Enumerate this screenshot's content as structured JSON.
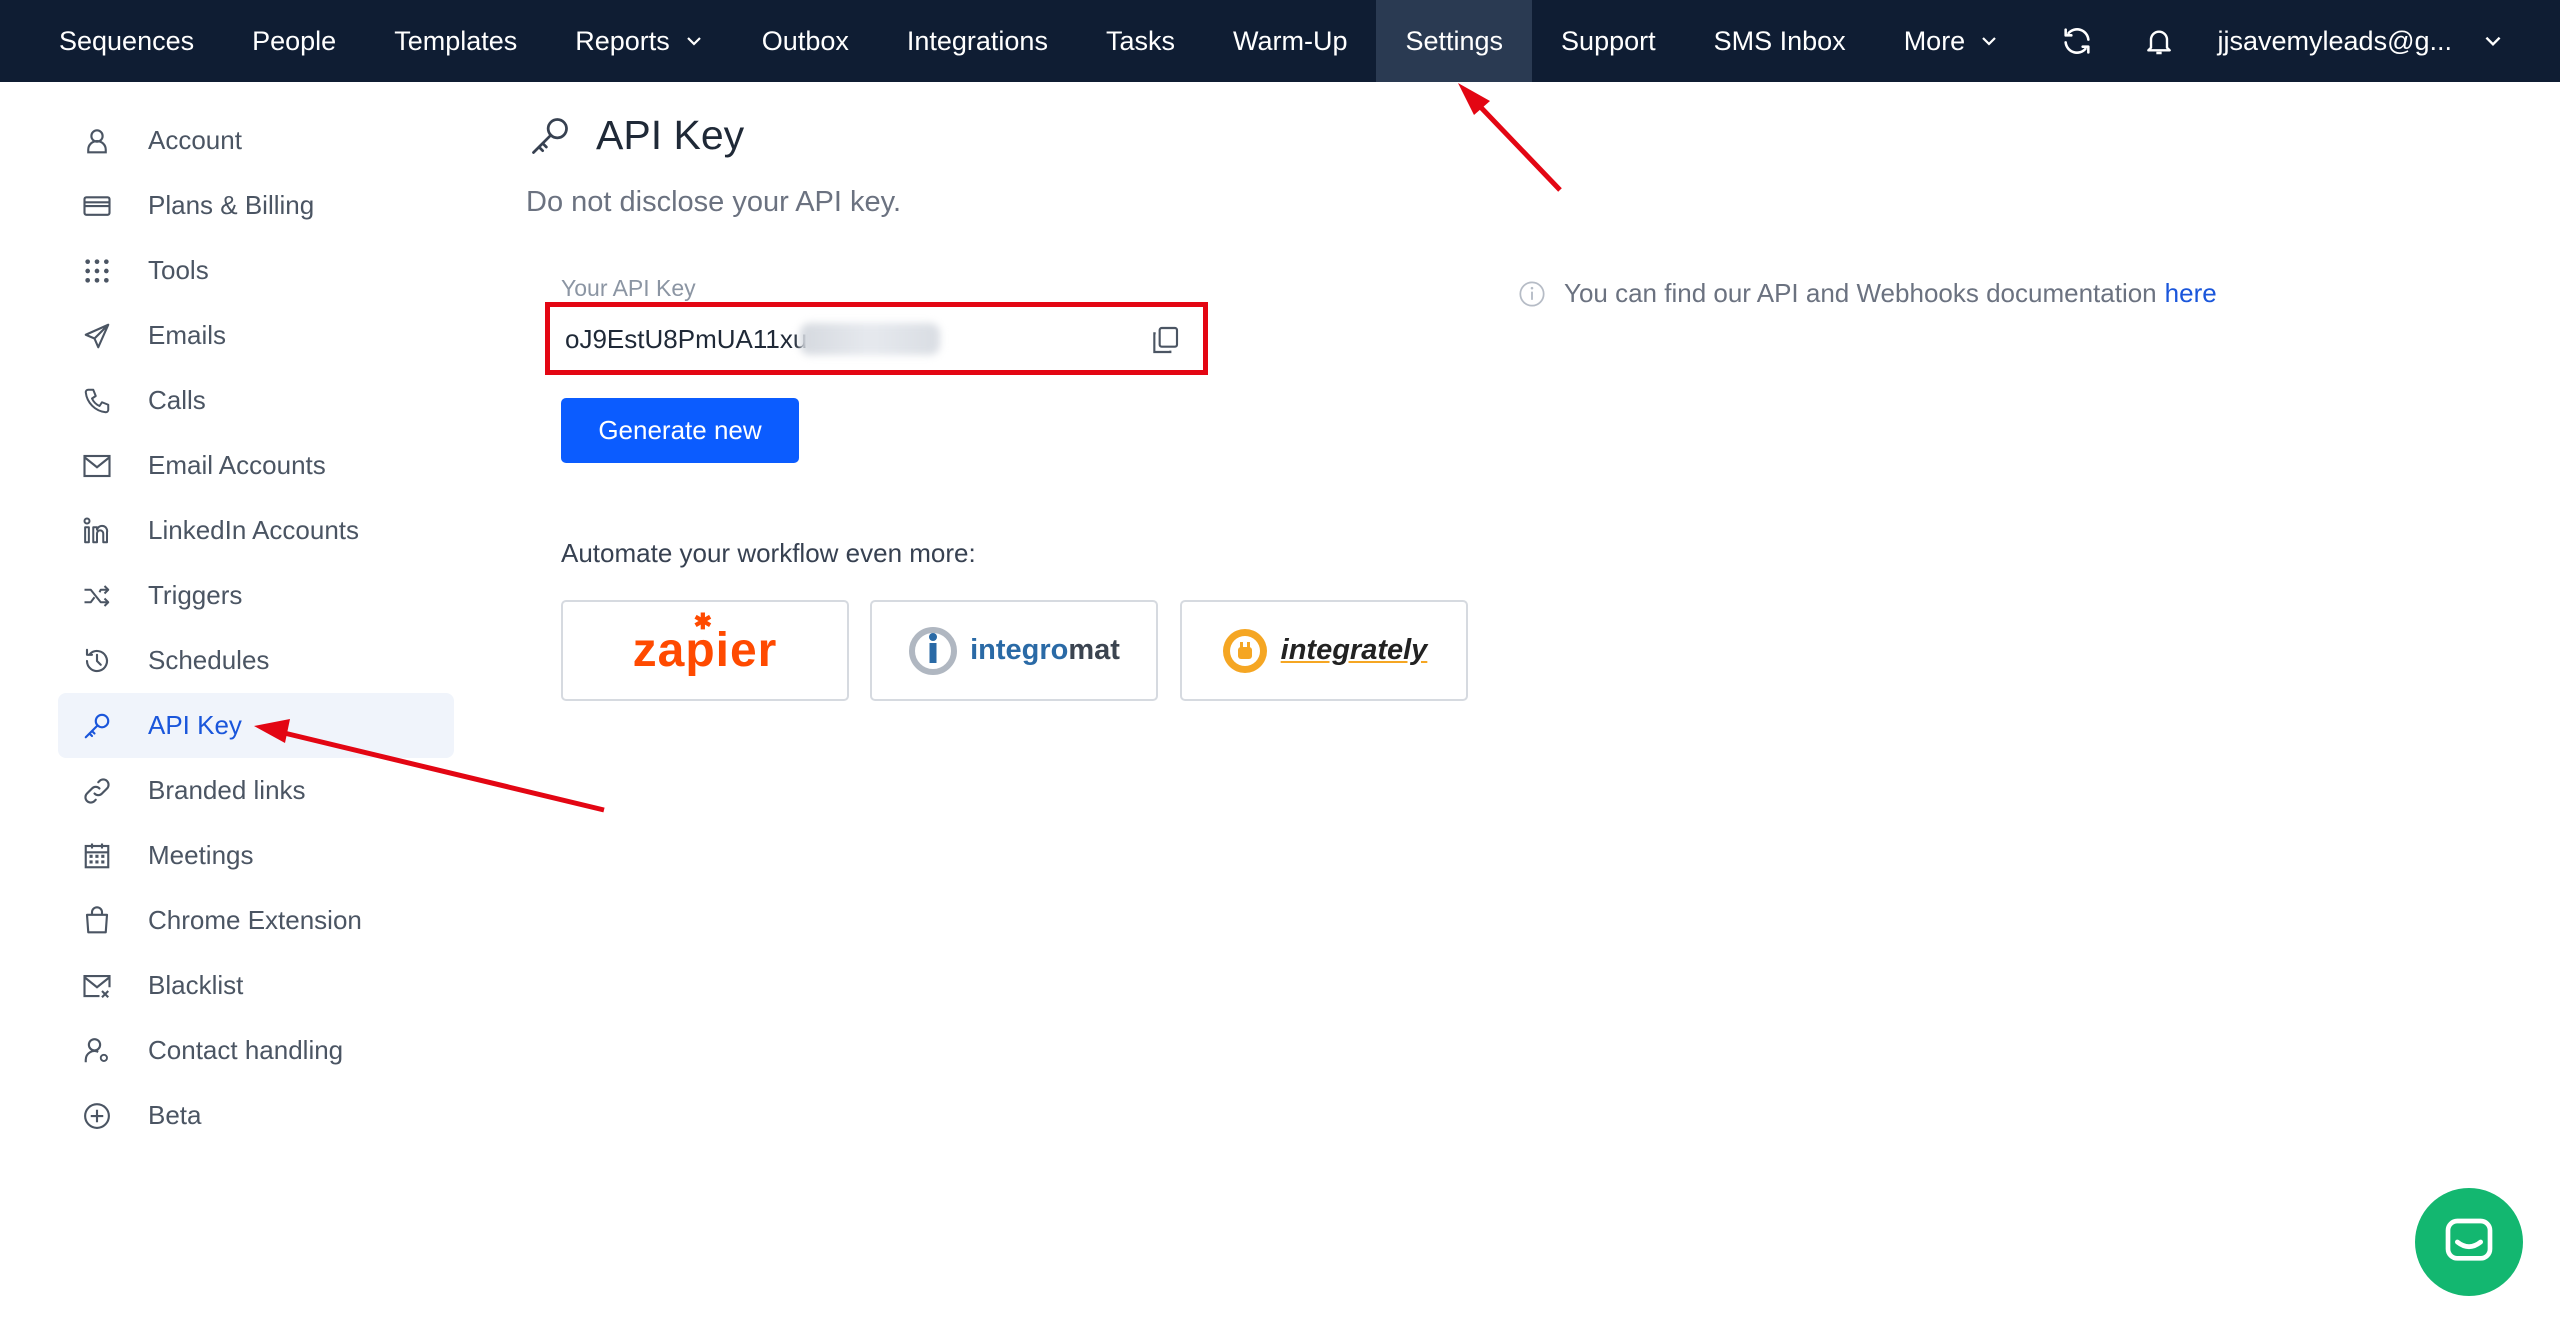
{
  "nav": {
    "items": [
      {
        "label": "Sequences"
      },
      {
        "label": "People"
      },
      {
        "label": "Templates"
      },
      {
        "label": "Reports"
      },
      {
        "label": "Outbox"
      },
      {
        "label": "Integrations"
      },
      {
        "label": "Tasks"
      },
      {
        "label": "Warm-Up"
      },
      {
        "label": "Settings"
      },
      {
        "label": "Support"
      },
      {
        "label": "SMS Inbox"
      },
      {
        "label": "More"
      }
    ],
    "active": "Settings",
    "user": "jjsavemyleads@g...",
    "icons": [
      "refresh-icon",
      "bell-icon",
      "chevron-down-icon"
    ]
  },
  "sidebar": {
    "items": [
      {
        "label": "Account",
        "icon": "user-icon"
      },
      {
        "label": "Plans & Billing",
        "icon": "credit-card-icon"
      },
      {
        "label": "Tools",
        "icon": "grid-icon"
      },
      {
        "label": "Emails",
        "icon": "paper-plane-icon"
      },
      {
        "label": "Calls",
        "icon": "phone-icon"
      },
      {
        "label": "Email Accounts",
        "icon": "envelope-icon"
      },
      {
        "label": "LinkedIn Accounts",
        "icon": "linkedin-icon"
      },
      {
        "label": "Triggers",
        "icon": "shuffle-icon"
      },
      {
        "label": "Schedules",
        "icon": "history-icon"
      },
      {
        "label": "API Key",
        "icon": "key-icon"
      },
      {
        "label": "Branded links",
        "icon": "link-icon"
      },
      {
        "label": "Meetings",
        "icon": "calendar-icon"
      },
      {
        "label": "Chrome Extension",
        "icon": "shopping-bag-icon"
      },
      {
        "label": "Blacklist",
        "icon": "envelope-x-icon"
      },
      {
        "label": "Contact handling",
        "icon": "user-settings-icon"
      },
      {
        "label": "Beta",
        "icon": "plus-circle-icon"
      }
    ],
    "active": "API Key"
  },
  "main": {
    "title": "API Key",
    "subtitle": "Do not disclose your API key.",
    "api_label": "Your API Key",
    "api_value": "oJ9EstU8PmUA11xu",
    "generate_label": "Generate new",
    "automate_label": "Automate your workflow even more:",
    "integrations": [
      {
        "name": "zapier"
      },
      {
        "name": "integromat",
        "part1": "integro",
        "part2": "mat"
      },
      {
        "name": "integrately"
      }
    ],
    "docs_text": "You can find our API and Webhooks documentation",
    "docs_link": "here"
  },
  "colors": {
    "nav_bg": "#0f1d33",
    "accent": "#0b5cff",
    "highlight": "#e30613",
    "chat": "#13b770"
  }
}
